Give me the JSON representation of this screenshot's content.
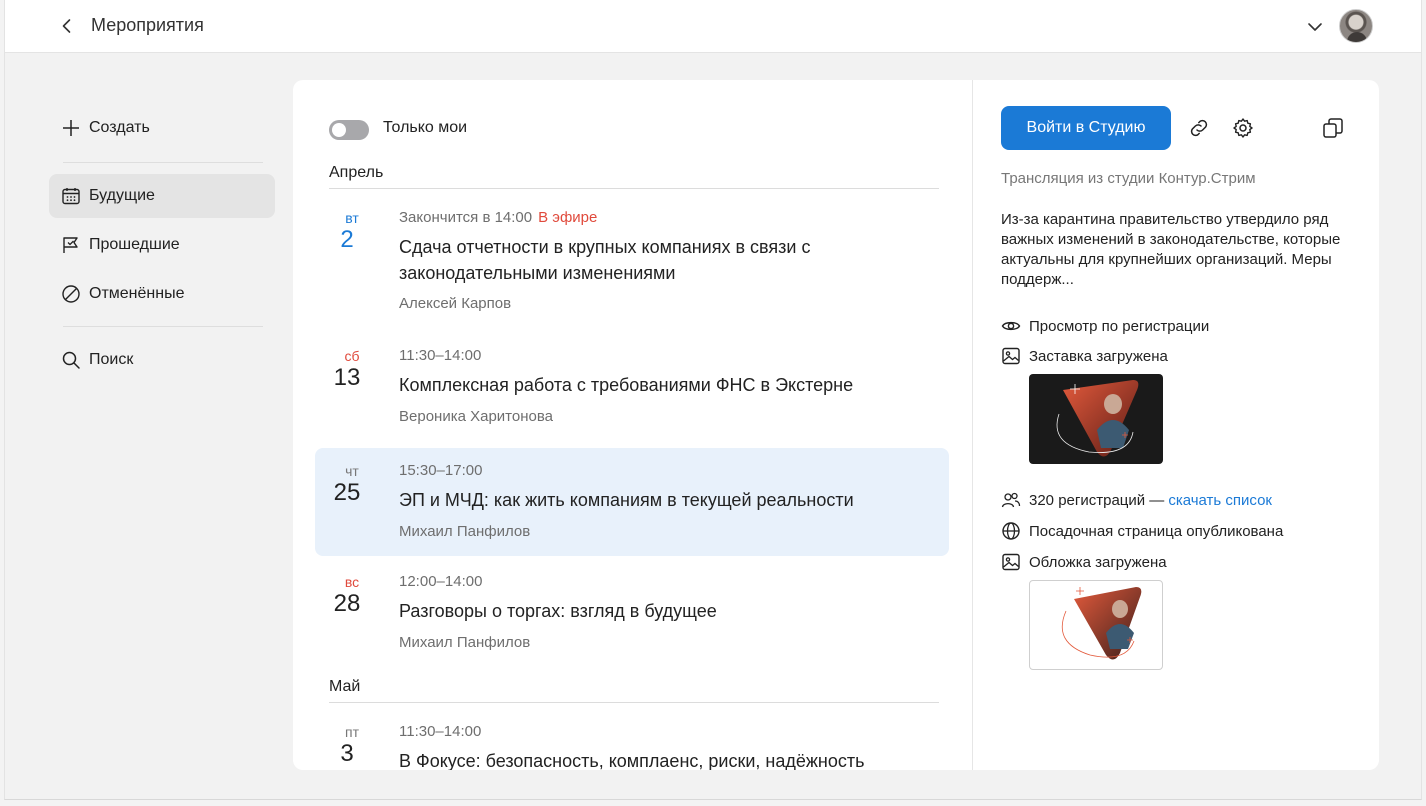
{
  "header": {
    "title": "Мероприятия"
  },
  "sidebar": {
    "create_label": "Создать",
    "items": [
      {
        "label": "Будущие"
      },
      {
        "label": "Прошедшие"
      },
      {
        "label": "Отменённые"
      }
    ],
    "search_label": "Поиск"
  },
  "list": {
    "toggle_label": "Только мои",
    "months": [
      {
        "name": "Апрель"
      },
      {
        "name": "Май"
      }
    ],
    "events": [
      {
        "weekday": "вт",
        "day": "2",
        "time": "Закончится в 14:00",
        "status": "В эфире",
        "title": "Сдача отчетности в крупных компаниях в связи с законодательными изменениями",
        "author": "Алексей Карпов"
      },
      {
        "weekday": "сб",
        "day": "13",
        "time": "11:30–14:00",
        "title": "Комплексная работа с требованиями ФНС в Экстерне",
        "author": "Вероника Харитонова"
      },
      {
        "weekday": "чт",
        "day": "25",
        "time": "15:30–17:00",
        "title": "ЭП и МЧД: как жить компаниям в текущей реальности",
        "author": "Михаил Панфилов"
      },
      {
        "weekday": "вс",
        "day": "28",
        "time": "12:00–14:00",
        "title": "Разговоры о торгах: взгляд в будущее",
        "author": "Михаил Панфилов"
      },
      {
        "weekday": "пт",
        "day": "3",
        "time": "11:30–14:00",
        "title": "В Фокусе: безопасность, комплаенс, риски, надёжность"
      }
    ]
  },
  "detail": {
    "studio_button": "Войти в Студию",
    "subtitle": "Трансляция из студии Контур.Стрим",
    "description": "Из-за карантина правительство утвердило ряд важных изменений в законодательстве, которые актуальны для крупнейших организаций. Меры поддерж...",
    "view_mode": "Просмотр по регистрации",
    "splash_status": "Заставка загружена",
    "registrations": "320 регистраций —",
    "download_link": "скачать список",
    "landing_status": "Посадочная страница опубликована",
    "cover_status": "Обложка загружена"
  },
  "colors": {
    "accent": "#1b7ad6",
    "live": "#e04a3c",
    "selected_row": "#e8f1fb"
  }
}
